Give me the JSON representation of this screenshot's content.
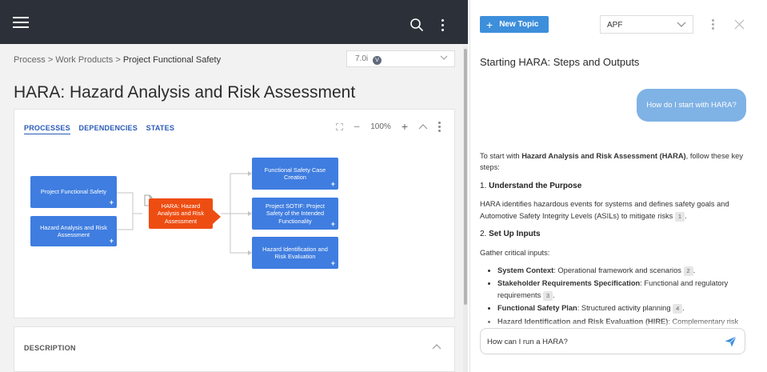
{
  "header": {
    "menu_icon": "hamburger-icon",
    "search_icon": "search-icon",
    "more_icon": "kebab-icon"
  },
  "breadcrumb": {
    "items": [
      "Process",
      "Work Products"
    ],
    "separator": ">",
    "current": "Project Functional Safety"
  },
  "version": {
    "value": "7.0i",
    "badge": "V"
  },
  "page": {
    "title": "HARA: Hazard Analysis and Risk Assessment"
  },
  "diagram": {
    "tabs": [
      "PROCESSES",
      "DEPENDENCIES",
      "STATES"
    ],
    "active_tab": "PROCESSES",
    "zoom": "100%",
    "nodes": {
      "pfs": "Project Functional Safety",
      "hara_input": "Hazard Analysis and Risk Assessment",
      "hara_center": "HARA: Hazard Analysis and Risk Assessment",
      "fsc": "Functional Safety Case Creation",
      "sotif": "Project SOTIF: Project Safety of the Intended Functionality",
      "hire": "Hazard Identification and Risk Evaluation"
    },
    "plus": "+"
  },
  "description": {
    "title": "DESCRIPTION"
  },
  "chat": {
    "new_topic_label": "New Topic",
    "select_value": "APF",
    "title": "Starting HARA: Steps and Outputs",
    "user_message": "How do I start with HARA?",
    "intro_a": "To start with ",
    "intro_b": "Hazard Analysis and Risk Assessment (HARA)",
    "intro_c": ", follow these key steps:",
    "step1_num": "1. ",
    "step1_title": "Understand the Purpose",
    "step1_text": "HARA identifies hazardous events for systems and defines safety goals and Automotive Safety Integrity Levels (ASILs) to mitigate risks",
    "cite1": "1",
    "step2_num": "2. ",
    "step2_title": "Set Up Inputs",
    "step2_text": "Gather critical inputs:",
    "bullets": [
      {
        "label": "System Context",
        "text": ": Operational framework and scenarios",
        "cite": "2"
      },
      {
        "label": "Stakeholder Requirements Specification",
        "text": ": Functional and regulatory requirements",
        "cite": "3"
      },
      {
        "label": "Functional Safety Plan",
        "text": ": Structured activity planning",
        "cite": "4"
      },
      {
        "label": "Hazard Identification and Risk Evaluation (HIRE)",
        "text": ": Complementary risk",
        "cite": ""
      }
    ],
    "input_value": "How can I run a HARA?",
    "send_icon": "send-icon"
  }
}
